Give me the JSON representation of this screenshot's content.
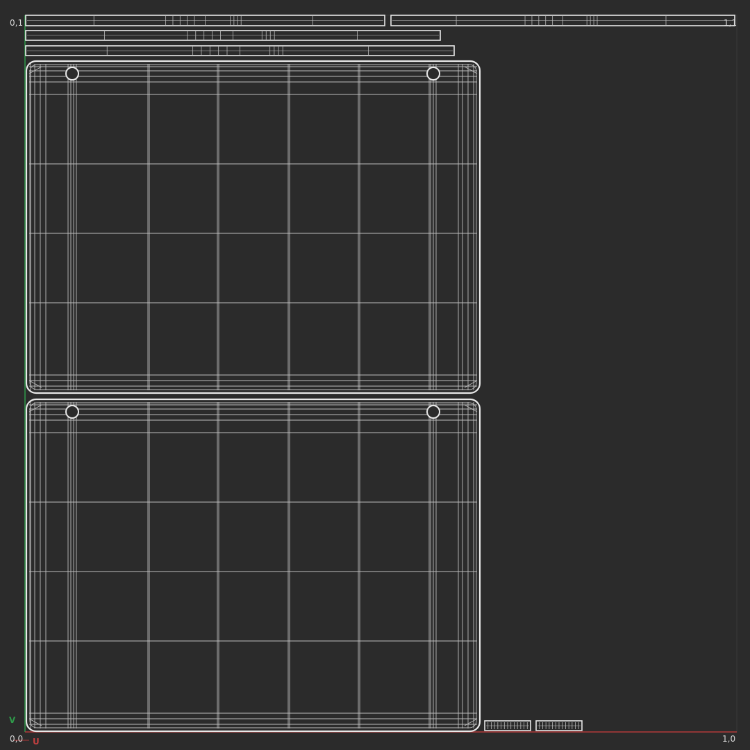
{
  "labels": {
    "top_left": "0,1",
    "top_right": "1,1",
    "bottom_left": "0,0",
    "bottom_right": "1,0",
    "v_axis": "V",
    "u_axis": "U"
  },
  "colors": {
    "background": "#2b2b2b",
    "grid_border": "#3a3a3a",
    "wire": "#bdbdbd",
    "outline": "#e8e8e8",
    "v_axis": "#2f9a4a",
    "u_axis": "#b23a3a"
  }
}
